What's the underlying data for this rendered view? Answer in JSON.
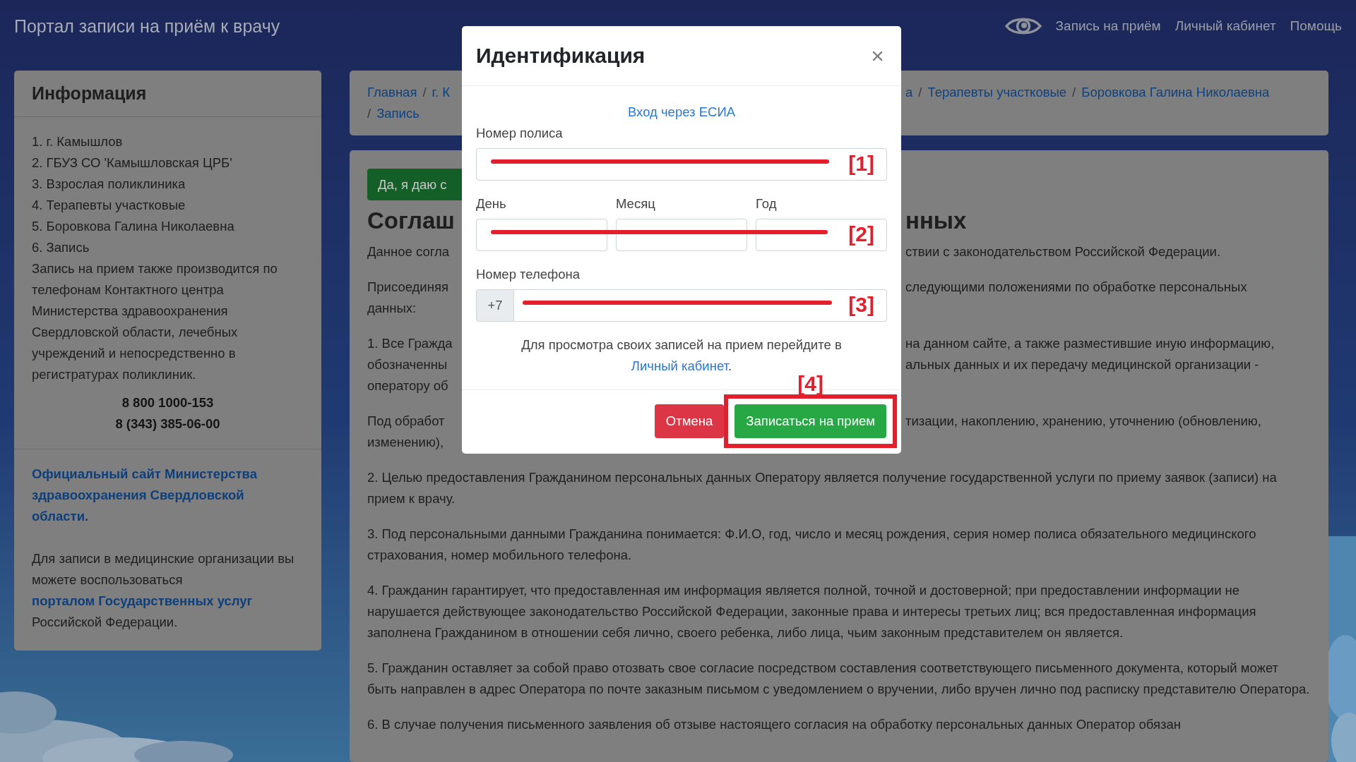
{
  "header": {
    "title": "Портал записи на приём к врачу",
    "nav": [
      "Запись на приём",
      "Личный кабинет",
      "Помощь"
    ]
  },
  "sidebar": {
    "title": "Информация",
    "steps": [
      "1. г. Камышлов",
      "2. ГБУЗ СО 'Камышловская ЦРБ'",
      "3. Взрослая поликлиника",
      "4. Терапевты участковые",
      "5. Боровкова Галина Николаевна",
      "6. Запись"
    ],
    "note": "Запись на прием также производится по телефонам Контактного центра Министерства здравоохранения Свердловской области, лечебных учреждений и непосредственно в регистратурах поликлиник.",
    "phones": [
      "8 800 1000-153",
      "8 (343) 385-06-00"
    ],
    "ministry_link": "Официальный сайт Министерства здравоохранения Свердловской области.",
    "gosuslugi": {
      "before": "Для записи в медицинские организации вы можете воспользоваться",
      "link": "порталом Государственных услуг",
      "after": "Российской Федерации."
    }
  },
  "breadcrumb": {
    "separator": "/",
    "left": [
      "Главная",
      "г. К"
    ],
    "right": [
      "а",
      "Терапевты участковые",
      "Боровкова Галина Николаевна"
    ],
    "second_line": [
      "Запись"
    ]
  },
  "agreement": {
    "consent_button": "Да, я даю с",
    "title": {
      "left": "Соглаш",
      "right": "нных"
    },
    "split_paragraphs": [
      {
        "lines": [
          {
            "left": "Данное согла",
            "right": "ствии с законодательством Российской Федерации."
          }
        ]
      },
      {
        "lines": [
          {
            "left": "Присоединяя",
            "right": "следующими положениями по обработке персональных"
          },
          {
            "left": "данных:"
          }
        ]
      },
      {
        "lines": [
          {
            "left": "1. Все Гражда",
            "right": "на данном сайте, а также разместившие иную информацию,"
          },
          {
            "left": "обозначенны",
            "right": "альных данных и их передачу медицинской организации -"
          },
          {
            "left": "оператору об"
          }
        ]
      },
      {
        "lines": [
          {
            "left": "Под обработ",
            "right": "тизации, накоплению, хранению, уточнению (обновлению,"
          },
          {
            "left": "изменению),"
          }
        ]
      }
    ],
    "paragraphs": [
      "2. Целью предоставления Гражданином персональных данных Оператору является получение государственной услуги по приему заявок (записи) на прием к врачу.",
      "3. Под персональными данными Гражданина понимается: Ф.И.О, год, число и месяц рождения, серия номер полиса обязательного медицинского страхования, номер мобильного телефона.",
      "4. Гражданин гарантирует, что предоставленная им информация является полной, точной и достоверной; при предоставлении информации не нарушается действующее законодательство Российской Федерации, законные права и интересы третьих лиц; вся предоставленная информация заполнена Гражданином в отношении себя лично, своего ребенка, либо лица, чьим законным представителем он является.",
      "5. Гражданин оставляет за собой право отозвать свое согласие посредством составления соответствующего письменного документа, который может быть направлен в адрес Оператора по почте заказным письмом с уведомлением о вручении, либо вручен лично под расписку представителю Оператора.",
      "6. В случае получения письменного заявления об отзыве настоящего согласия на обработку персональных данных Оператор обязан"
    ]
  },
  "modal": {
    "title": "Идентификация",
    "close": "×",
    "esia_link": "Вход через ЕСИА",
    "fields": [
      {
        "kind": "text",
        "label": "Номер полиса",
        "annotation": "[1]"
      },
      {
        "kind": "date",
        "labels": [
          "День",
          "Месяц",
          "Год"
        ],
        "annotation": "[2]"
      },
      {
        "kind": "phone",
        "label": "Номер телефона",
        "prefix": "+7",
        "annotation": "[3]"
      }
    ],
    "note": {
      "before": "Для просмотра своих записей на прием перейдите в",
      "link": "Личный кабинет",
      "after": "."
    },
    "buttons": [
      {
        "kind": "cancel",
        "label": "Отмена"
      },
      {
        "kind": "submit",
        "label": "Записаться на прием",
        "annotation": "[4]"
      }
    ]
  }
}
